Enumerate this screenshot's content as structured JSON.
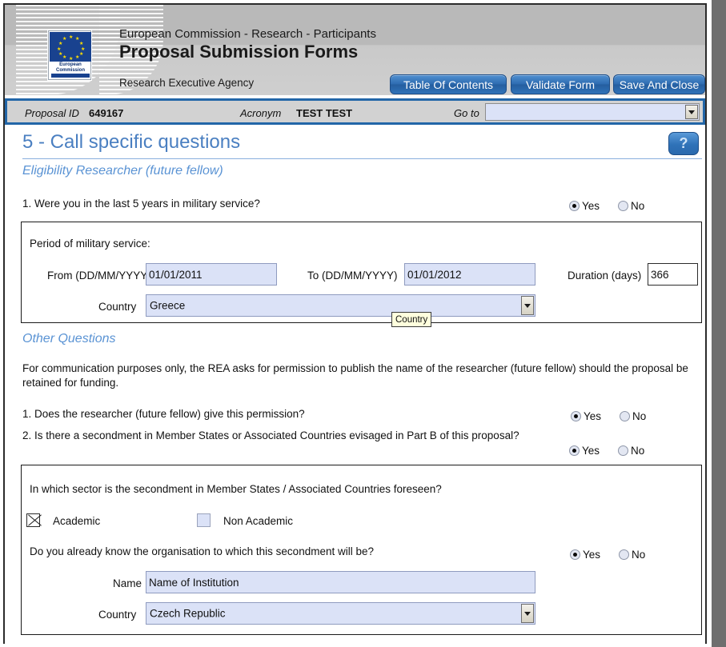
{
  "banner": {
    "line1": "European Commission - Research - Participants",
    "title": "Proposal Submission Forms",
    "agency": "Research Executive Agency",
    "logo_text": "European Commission"
  },
  "toolbar": {
    "table_of_contents": "Table Of Contents",
    "validate_form": "Validate Form",
    "save_and_close": "Save And Close"
  },
  "idbar": {
    "proposal_id_label": "Proposal ID",
    "proposal_id_value": "649167",
    "acronym_label": "Acronym",
    "acronym_value": "TEST TEST",
    "goto_label": "Go to",
    "goto_value": ""
  },
  "page": {
    "title": "5 - Call specific questions",
    "help_label": "?"
  },
  "sections": {
    "eligibility_heading": "Eligibility Researcher (future fellow)",
    "other_heading": "Other Questions"
  },
  "q_military": {
    "question": "1. Were you in the last 5 years in military service?",
    "yes_label": "Yes",
    "no_label": "No",
    "selected": "Yes"
  },
  "military_panel": {
    "heading": "Period of military service:",
    "from_label": "From (DD/MM/YYYY)",
    "from_value": "01/01/2011",
    "to_label": "To (DD/MM/YYYY)",
    "to_value": "01/01/2012",
    "duration_label": "Duration (days)",
    "duration_value": "366",
    "country_label": "Country",
    "country_value": "Greece",
    "tooltip": "Country"
  },
  "other": {
    "intro": "For communication purposes only, the REA asks for permission to publish the name of the researcher (future fellow) should the proposal be retained for funding.",
    "q1": {
      "question": "1. Does the researcher (future fellow) give this permission?",
      "yes_label": "Yes",
      "no_label": "No",
      "selected": "Yes"
    },
    "q2": {
      "question": "2. Is there a secondment in Member States or Associated Countries evisaged in Part B of this proposal?",
      "yes_label": "Yes",
      "no_label": "No",
      "selected": "Yes"
    }
  },
  "secondment_panel": {
    "sector_question": "In which sector is the secondment in Member States / Associated Countries foreseen?",
    "academic_label": "Academic",
    "academic_checked": true,
    "non_academic_label": "Non Academic",
    "non_academic_checked": false,
    "know_org_question": "Do you already know the organisation to which this secondment will be?",
    "know_org_yes": "Yes",
    "know_org_no": "No",
    "know_org_selected": "Yes",
    "name_label": "Name",
    "name_value": "Name of Institution",
    "country_label": "Country",
    "country_value": "Czech Republic"
  },
  "colors": {
    "accent_blue": "#2f72b8",
    "title_blue": "#4a7fc1",
    "field_fill": "#dbe2f7",
    "tooltip_bg": "#ffffdd"
  }
}
